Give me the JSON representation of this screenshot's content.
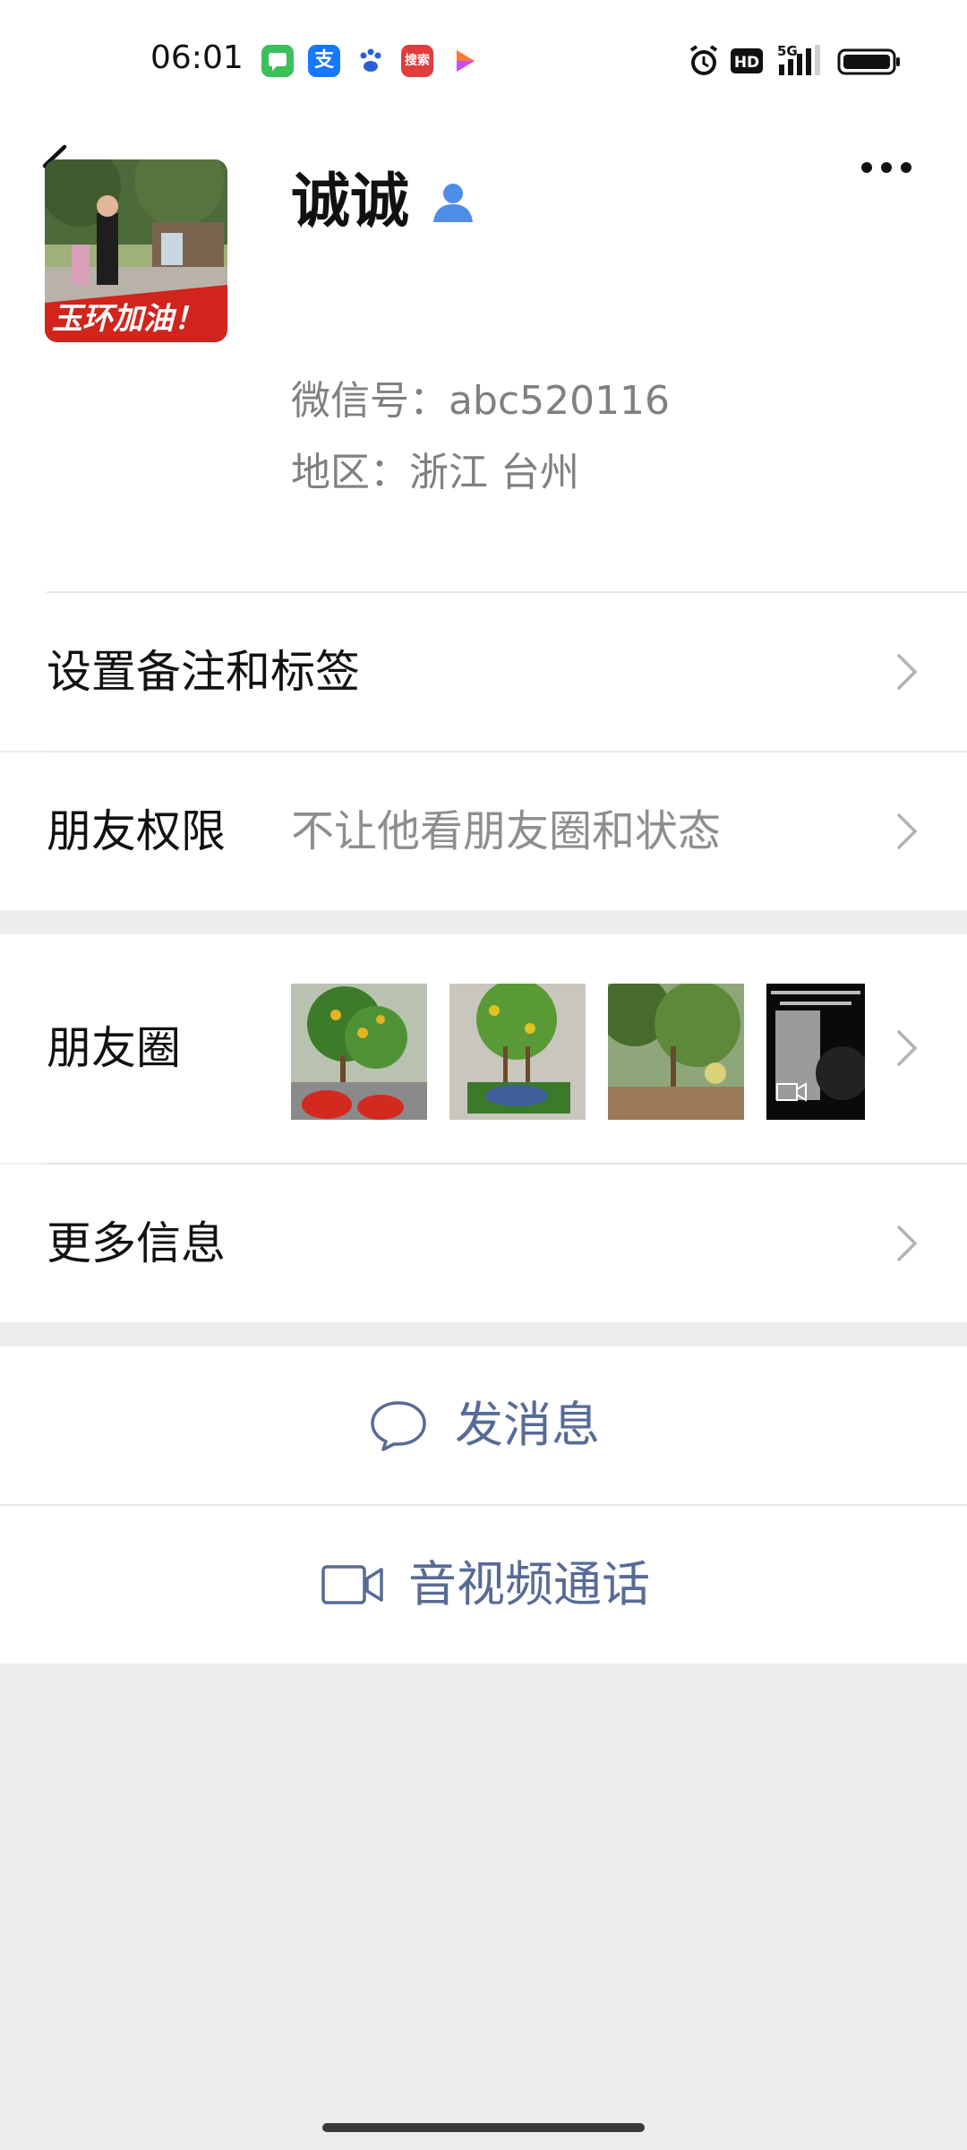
{
  "status_bar": {
    "time": "06:01",
    "apps": [
      {
        "icon": "chat-icon",
        "color": "#3cc05a"
      },
      {
        "icon": "alipay-icon",
        "color": "#1677ff",
        "glyph": "支"
      },
      {
        "icon": "baidu-icon",
        "color": "#2b5fd9"
      },
      {
        "icon": "sousuo-icon",
        "color": "#e23c3c",
        "glyph": "搜索"
      },
      {
        "icon": "video-icon",
        "color": "#ff7a2e"
      }
    ],
    "network": "5G"
  },
  "profile": {
    "name": "诚诚",
    "wechat_id": "微信号：abc520116",
    "region": "地区：浙江  台州",
    "avatar_caption": "玉环加油！"
  },
  "rows": {
    "remark_label": "设置备注和标签",
    "permission_label": "朋友权限",
    "permission_value": "不让他看朋友圈和状态",
    "moments_label": "朋友圈",
    "more_info_label": "更多信息"
  },
  "actions": {
    "message_label": "发消息",
    "call_label": "音视频通话"
  },
  "colors": {
    "link_blue": "#576b95",
    "page_bg": "#ededed",
    "gray_text": "#808080"
  }
}
